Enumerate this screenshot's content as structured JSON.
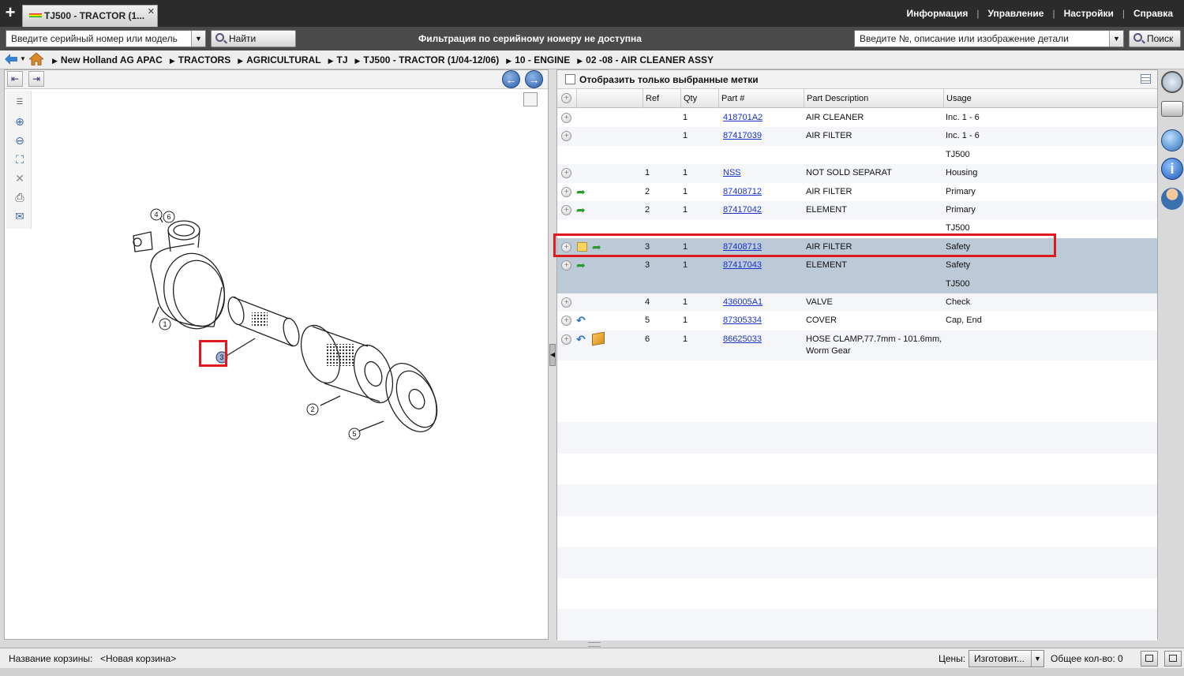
{
  "tab": {
    "title": "TJ500 - TRACTOR (1...",
    "close": "✕",
    "add": "+"
  },
  "top_menu": [
    "Информация",
    "Управление",
    "Настройки",
    "Справка"
  ],
  "search": {
    "model_placeholder": "Введите серийный номер или модель",
    "find_model_label": "Найти модель",
    "filter_message": "Фильтрация по серийному номеру не доступна",
    "part_placeholder": "Введите №, описание или изображение детали",
    "search_label": "Поиск"
  },
  "breadcrumb": [
    "New Holland AG APAC",
    "TRACTORS",
    "AGRICULTURAL",
    "TJ",
    "TJ500 - TRACTOR (1/04-12/06)",
    "10 - ENGINE",
    "02 -08 - AIR CLEANER ASSY"
  ],
  "filter_checkbox_label": "Отобразить только выбранные метки",
  "columns": {
    "ref": "Ref",
    "qty": "Qty",
    "part": "Part #",
    "desc": "Part Description",
    "usage": "Usage"
  },
  "parts": [
    {
      "ref": "",
      "qty": "1",
      "part": "418701A2",
      "desc": "AIR CLEANER",
      "usage": "Inc. 1 - 6",
      "icons": []
    },
    {
      "ref": "",
      "qty": "1",
      "part": "87417039",
      "desc": "AIR FILTER",
      "usage": "Inc. 1 - 6",
      "icons": []
    },
    {
      "ref": "",
      "qty": "",
      "part": "",
      "desc": "",
      "usage": "TJ500",
      "icons": [],
      "continuation": true
    },
    {
      "ref": "1",
      "qty": "1",
      "part": "NSS",
      "desc": "NOT SOLD SEPARAT",
      "usage": "Housing",
      "icons": []
    },
    {
      "ref": "2",
      "qty": "1",
      "part": "87408712",
      "desc": "AIR FILTER",
      "usage": "Primary",
      "icons": [
        "green-arrow"
      ]
    },
    {
      "ref": "2",
      "qty": "1",
      "part": "87417042",
      "desc": "ELEMENT",
      "usage": "Primary",
      "icons": [
        "green-arrow"
      ]
    },
    {
      "ref": "",
      "qty": "",
      "part": "",
      "desc": "",
      "usage": "TJ500",
      "icons": [],
      "continuation": true
    },
    {
      "ref": "3",
      "qty": "1",
      "part": "87408713",
      "desc": "AIR FILTER",
      "usage": "Safety",
      "icons": [
        "note",
        "green-arrow"
      ],
      "selected": true
    },
    {
      "ref": "3",
      "qty": "1",
      "part": "87417043",
      "desc": "ELEMENT",
      "usage": "Safety",
      "icons": [
        "green-arrow"
      ],
      "selected": true
    },
    {
      "ref": "",
      "qty": "",
      "part": "",
      "desc": "",
      "usage": "TJ500",
      "icons": [],
      "continuation": true,
      "selected": true
    },
    {
      "ref": "4",
      "qty": "1",
      "part": "436005A1",
      "desc": "VALVE",
      "usage": "Check",
      "icons": []
    },
    {
      "ref": "5",
      "qty": "1",
      "part": "87305334",
      "desc": "COVER",
      "usage": "Cap, End",
      "icons": [
        "blue-arrow"
      ]
    },
    {
      "ref": "6",
      "qty": "1",
      "part": "86625033",
      "desc": "HOSE CLAMP,77.7mm - 101.6mm,",
      "desc2": "Worm Gear",
      "usage": "",
      "icons": [
        "blue-arrow",
        "box"
      ]
    }
  ],
  "drawing_callouts": [
    "1",
    "2",
    "3",
    "4",
    "5",
    "6"
  ],
  "status": {
    "cart_label": "Название корзины:",
    "cart_name": "<Новая корзина>",
    "prices_label": "Цены:",
    "prices_value": "Изготовит...",
    "total_label": "Общее кол-во: 0"
  }
}
